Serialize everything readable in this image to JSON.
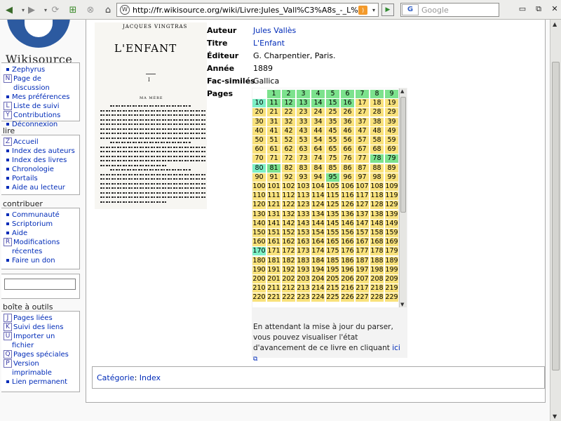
{
  "browser": {
    "url": "http://fr.wikisource.org/wiki/Livre:Jules_Vall%C3%A8s_-_L%27Enfant",
    "search_placeholder": "Google",
    "search_engine_label": "G"
  },
  "sidebar": {
    "logo_text": "Wikisource",
    "personal": [
      {
        "ak": "",
        "label": "Zephyrus"
      },
      {
        "ak": "N",
        "label": "Page de discussion"
      },
      {
        "ak": "",
        "label": "Mes préférences"
      },
      {
        "ak": "L",
        "label": "Liste de suivi"
      },
      {
        "ak": "Y",
        "label": "Contributions"
      },
      {
        "ak": "",
        "label": "Déconnexion"
      }
    ],
    "lire_title": "lire",
    "lire": [
      {
        "ak": "Z",
        "label": "Accueil"
      },
      {
        "ak": "",
        "label": "Index des auteurs"
      },
      {
        "ak": "",
        "label": "Index des livres"
      },
      {
        "ak": "",
        "label": "Chronologie"
      },
      {
        "ak": "",
        "label": "Portails"
      },
      {
        "ak": "",
        "label": "Aide au lecteur"
      }
    ],
    "contribuer_title": "contribuer",
    "contribuer": [
      {
        "ak": "",
        "label": "Communauté"
      },
      {
        "ak": "",
        "label": "Scriptorium"
      },
      {
        "ak": "",
        "label": "Aide"
      },
      {
        "ak": "R",
        "label": "Modifications"
      },
      {
        "ak": "ind",
        "label": "récentes"
      },
      {
        "ak": "",
        "label": "Faire un don"
      }
    ],
    "outils_title": "boîte à outils",
    "outils": [
      {
        "ak": "J",
        "label": "Pages liées"
      },
      {
        "ak": "K",
        "label": "Suivi des liens"
      },
      {
        "ak": "U",
        "label": "Importer un"
      },
      {
        "ak": "ind",
        "label": "fichier"
      },
      {
        "ak": "Q",
        "label": "Pages spéciales"
      },
      {
        "ak": "P",
        "label": "Version"
      },
      {
        "ak": "ind",
        "label": "imprimable"
      },
      {
        "ak": "",
        "label": "Lien permanent"
      }
    ]
  },
  "scan": {
    "author": "JACQUES VINGTRAS",
    "title": "L'ENFANT",
    "chapter": "I",
    "chapter_title": "MA MÈRE"
  },
  "book": {
    "auteur_label": "Auteur",
    "auteur": "Jules Vallès",
    "titre_label": "Titre",
    "titre": "L'Enfant",
    "editeur_label": "Éditeur",
    "editeur": "G. Charpentier, Paris.",
    "annee_label": "Année",
    "annee": "1889",
    "facsim_label": "Fac-similés",
    "facsim": "Gallica",
    "pages_label": "Pages"
  },
  "pages": {
    "green": [
      1,
      2,
      3,
      4,
      5,
      6,
      7,
      8,
      9,
      11,
      12,
      13,
      14,
      15,
      16,
      78,
      79,
      81,
      95,
      170
    ],
    "teal": [
      10,
      80,
      170
    ],
    "white_first_row": [],
    "visible_count": 229,
    "note": "En attendant la mise à jour du parser, vous pouvez visualiser l'état d'avancement de ce livre en cliquant",
    "note_link": "ici"
  },
  "category": {
    "label": "Catégorie",
    "value": "Index"
  },
  "colors": {
    "link": "#002bb8",
    "proofread": "#f9e27c",
    "validated": "#7ce28d",
    "teal": "#7df0c6"
  }
}
